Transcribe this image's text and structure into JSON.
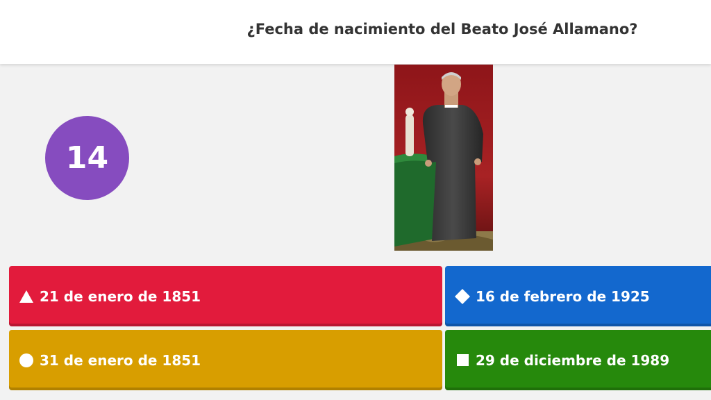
{
  "question": "¿Fecha de nacimiento del Beato José Allamano?",
  "timer": "14",
  "answers": [
    {
      "label": "21 de enero de 1851",
      "icon": "triangle-icon",
      "color": "#e21b3c"
    },
    {
      "label": "16 de febrero de 1925",
      "icon": "diamond-icon",
      "color": "#1368ce"
    },
    {
      "label": "31 de enero de 1851",
      "icon": "circle-icon",
      "color": "#d89e00"
    },
    {
      "label": "29 de diciembre de 1989",
      "icon": "square-icon",
      "color": "#26890c"
    }
  ],
  "timer_color": "#864cbf"
}
